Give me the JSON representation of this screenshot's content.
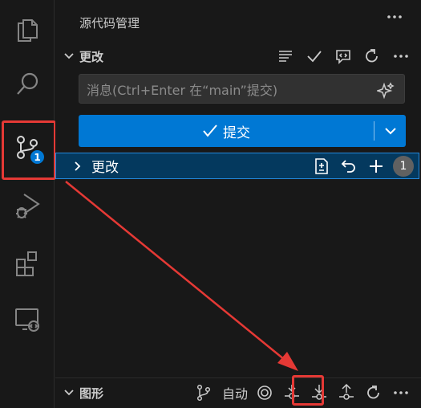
{
  "sidebar": {
    "title": "源代码管理",
    "changes_section": {
      "title": "更改",
      "message_placeholder": "消息(Ctrl+Enter 在“main”提交)",
      "commit_label": "提交",
      "changes_group_label": "更改",
      "changes_count": "1"
    },
    "graph_section": {
      "title": "图形",
      "auto_label": "自动"
    }
  },
  "activitybar": {
    "source_control_badge": "1",
    "items": [
      "explorer-icon",
      "search-icon",
      "source-control-icon",
      "run-debug-icon",
      "extensions-icon",
      "remote-explorer-icon"
    ]
  },
  "colors": {
    "accent": "#0078d4",
    "highlight": "#e53935",
    "selection": "#04395e"
  }
}
